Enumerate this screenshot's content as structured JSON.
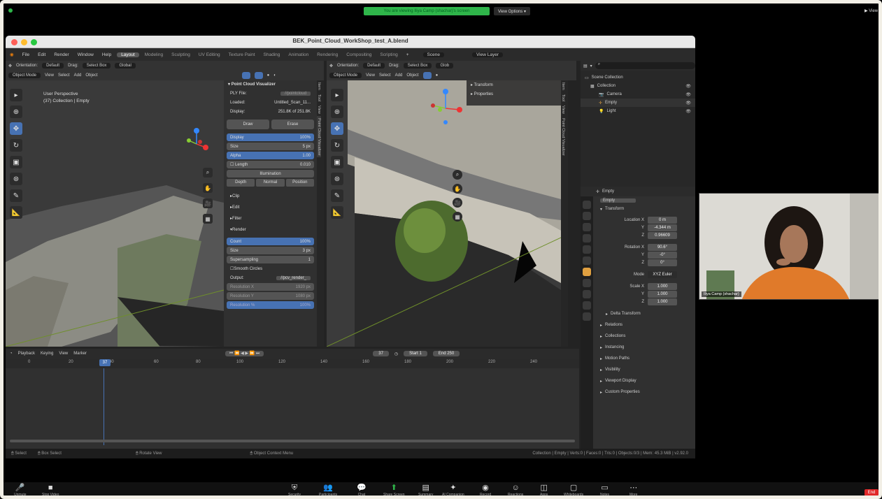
{
  "zoom": {
    "share_banner": "You are viewing Iliya Camp (shachar)'s screen",
    "view_options": "View Options ▾",
    "view_top_right": "▶ View",
    "toolbar": [
      {
        "name": "mute-icon",
        "glyph": "🎤",
        "label": "Unmute"
      },
      {
        "name": "video-icon",
        "glyph": "■",
        "label": "Stop Video"
      },
      {
        "name": "security-icon",
        "glyph": "⛨",
        "label": "Security"
      },
      {
        "name": "participants-icon",
        "glyph": "👥",
        "label": "Participants"
      },
      {
        "name": "chat-icon",
        "glyph": "💬",
        "label": "Chat"
      },
      {
        "name": "share-screen-icon",
        "glyph": "⬆",
        "label": "Share Screen"
      },
      {
        "name": "summary-icon",
        "glyph": "▤",
        "label": "Summary"
      },
      {
        "name": "ai-companion-icon",
        "glyph": "✦",
        "label": "AI Companion"
      },
      {
        "name": "record-icon",
        "glyph": "◉",
        "label": "Record"
      },
      {
        "name": "reactions-icon",
        "glyph": "☺",
        "label": "Reactions"
      },
      {
        "name": "apps-icon",
        "glyph": "◫",
        "label": "Apps"
      },
      {
        "name": "whiteboards-icon",
        "glyph": "▢",
        "label": "Whiteboards"
      },
      {
        "name": "notes-icon",
        "glyph": "▭",
        "label": "Notes"
      },
      {
        "name": "more-icon",
        "glyph": "⋯",
        "label": "More"
      }
    ],
    "end_label": "End"
  },
  "window": {
    "title": "BEK_Point_Cloud_WorkShop_test_A.blend"
  },
  "topbar": {
    "menus": [
      "File",
      "Edit",
      "Render",
      "Window",
      "Help"
    ],
    "workspaces": [
      "Layout",
      "Modeling",
      "Sculpting",
      "UV Editing",
      "Texture Paint",
      "Shading",
      "Animation",
      "Rendering",
      "Compositing",
      "Scripting"
    ],
    "active_workspace": "Layout",
    "scene": "Scene",
    "view_layer": "View Layer"
  },
  "viewport_left": {
    "header1": [
      "Orientation:",
      "Default",
      "Drag:",
      "Select Box",
      "Global"
    ],
    "header2": [
      "Object Mode",
      "View",
      "Select",
      "Add",
      "Object"
    ],
    "perspective": "User Perspective",
    "collection": "(37) Collection | Empty"
  },
  "pc_panel": {
    "title": "Point Cloud Visualizer",
    "ply_label": "PLY File:",
    "ply_value": "//pointcloud",
    "loaded_label": "Loaded:",
    "loaded_value": "Untitled_Scan_11...",
    "display_label": "Display:",
    "display_value": "251.8K of 251.8K",
    "draw": "Draw",
    "erase": "Erase",
    "display": "Display",
    "display_pct": "100%",
    "size": "Size",
    "size_val": "5 px",
    "alpha": "Alpha",
    "alpha_val": "1.00",
    "length": "Length",
    "length_val": "0.010",
    "illumination": "Illumination",
    "depth": "Depth",
    "normal": "Normal",
    "position": "Position",
    "clip": "Clip",
    "edit": "Edit",
    "filter": "Filter",
    "render": "Render",
    "count": "Count",
    "count_val": "100%",
    "rsize": "Size",
    "rsize_val": "3 px",
    "supersampling": "Supersampling",
    "ss_val": "1",
    "smooth": "Smooth Circles",
    "output_label": "Output:",
    "output_val": "//pcv_render_",
    "res_x": "Resolution X",
    "res_x_val": "1920 px",
    "res_y": "Resolution Y",
    "res_y_val": "1080 px",
    "res_pct": "Resolution %",
    "res_pct_val": "100%",
    "sidetabs": [
      "Item",
      "Tool",
      "View",
      "Point Cloud Visualizer"
    ]
  },
  "viewport_right": {
    "header1": [
      "Orientation:",
      "Default",
      "Drag:",
      "Select Box",
      "Glob"
    ],
    "header2": [
      "Object Mode",
      "View",
      "Select",
      "Add",
      "Object"
    ],
    "npanel": [
      "Transform",
      "Properties"
    ],
    "sidetabs": [
      "Item",
      "Tool",
      "View",
      "Point Cloud Visualizer"
    ]
  },
  "outliner": {
    "search_placeholder": "",
    "items": [
      {
        "label": "Scene Collection",
        "indent": 0
      },
      {
        "label": "Collection",
        "indent": 1
      },
      {
        "label": "Camera",
        "indent": 2
      },
      {
        "label": "Empty",
        "indent": 2
      },
      {
        "label": "Light",
        "indent": 2
      }
    ]
  },
  "properties": {
    "object_name": "Empty",
    "data_name": "Empty",
    "transform": "Transform",
    "location_x_label": "Location X",
    "location_x": "0 m",
    "location_y": "-4.344 m",
    "location_z": "0.96609",
    "rotation_x_label": "Rotation X",
    "rotation_x": "90.6°",
    "rotation_y": "-0°",
    "rotation_z": "0°",
    "mode_label": "Mode",
    "mode_val": "XYZ Euler",
    "scale_x_label": "Scale X",
    "scale_x": "1.000",
    "scale_y": "1.000",
    "scale_z": "1.000",
    "y": "Y",
    "z": "Z",
    "sections": [
      "Delta Transform",
      "Relations",
      "Collections",
      "Instancing",
      "Motion Paths",
      "Visibility",
      "Viewport Display",
      "Custom Properties"
    ]
  },
  "timeline": {
    "header": [
      "Playback",
      "Keying",
      "View",
      "Marker"
    ],
    "current_frame": "37",
    "start_label": "Start",
    "start": "1",
    "end_label": "End",
    "end": "250",
    "ticks": [
      "0",
      "20",
      "40",
      "60",
      "80",
      "100",
      "120",
      "140",
      "160",
      "180",
      "200",
      "220",
      "240"
    ]
  },
  "statusbar": {
    "items": [
      "Select",
      "Box Select",
      "Rotate View",
      "Object Context Menu"
    ],
    "info": "Collection | Empty | Verts:0 | Faces:0 | Tris:0 | Objects:0/3 | Mem: 45.3 MiB | v2.92.0"
  },
  "webcam": {
    "name": "Iliya Camp (shachar)"
  }
}
